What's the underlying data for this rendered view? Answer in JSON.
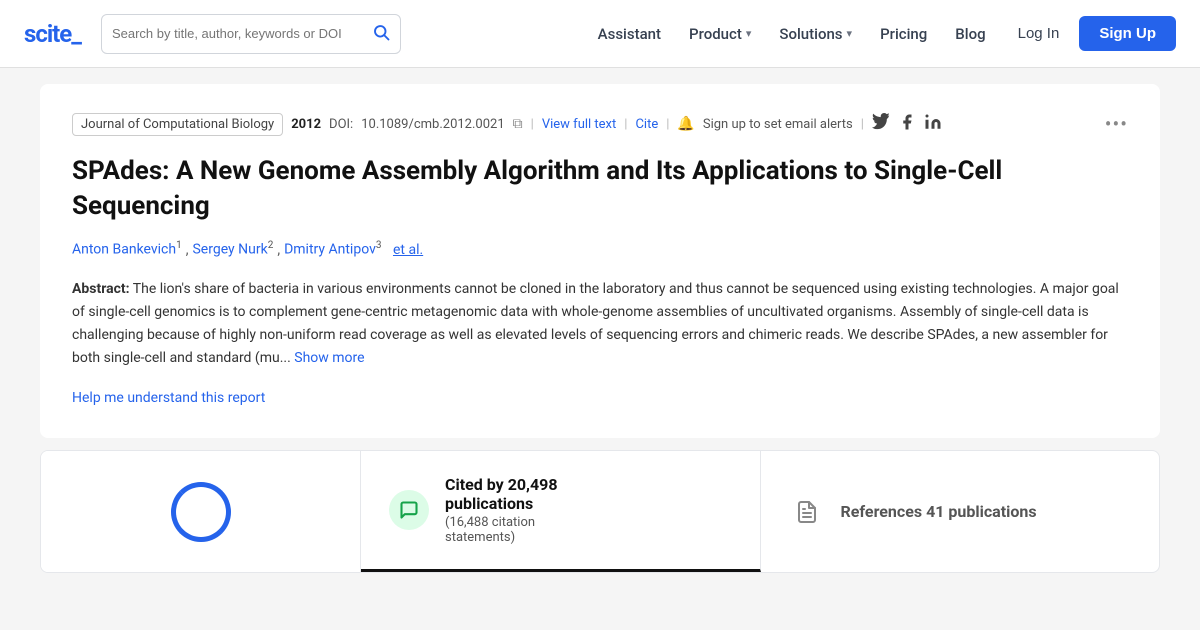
{
  "navbar": {
    "logo": "scite_",
    "search_placeholder": "Search by title, author, keywords or DOI",
    "nav_items": [
      {
        "label": "Assistant",
        "has_dropdown": false
      },
      {
        "label": "Product",
        "has_dropdown": true
      },
      {
        "label": "Solutions",
        "has_dropdown": true
      },
      {
        "label": "Pricing",
        "has_dropdown": false
      },
      {
        "label": "Blog",
        "has_dropdown": false
      }
    ],
    "login_label": "Log In",
    "signup_label": "Sign Up"
  },
  "article": {
    "journal": "Journal of Computational Biology",
    "year": "2012",
    "doi_label": "DOI:",
    "doi_value": "10.1089/cmb.2012.0021",
    "view_full_text": "View full text",
    "cite_label": "Cite",
    "alert_text": "Sign up to set email alerts",
    "more_icon": "•••",
    "title": "SPAdes: A New Genome Assembly Algorithm and Its Applications to Single-Cell Sequencing",
    "authors": [
      {
        "name": "Anton Bankevich",
        "sup": "1"
      },
      {
        "name": "Sergey Nurk",
        "sup": "2"
      },
      {
        "name": "Dmitry Antipov",
        "sup": "3"
      }
    ],
    "et_al": "et al.",
    "abstract_label": "Abstract:",
    "abstract_text": "The lion's share of bacteria in various environments cannot be cloned in the laboratory and thus cannot be sequenced using existing technologies. A major goal of single-cell genomics is to complement gene-centric metagenomic data with whole-genome assemblies of uncultivated organisms. Assembly of single-cell data is challenging because of highly non-uniform read coverage as well as elevated levels of sequencing errors and chimeric reads. We describe SPAdes, a new assembler for both single-cell and standard (mu...",
    "show_more": "Show more",
    "help_link": "Help me understand this report"
  },
  "stats": {
    "cited_by_label": "Cited by 20,498",
    "cited_by_sub": "publications",
    "citation_statements": "(16,488 citation",
    "citation_statements2": "statements)",
    "references_label": "References 41 publications"
  }
}
